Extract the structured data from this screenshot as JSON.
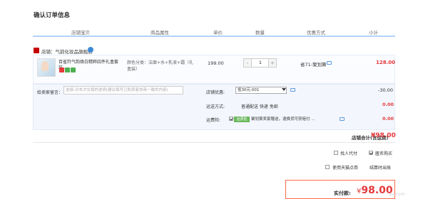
{
  "title": "确认订单信息",
  "columns": [
    "店铺宝贝",
    "商品属性",
    "单价",
    "数量",
    "优惠方式",
    "小计"
  ],
  "store": {
    "label": "店铺：气韵化妆品旗舰店"
  },
  "item": {
    "name_line1": "百雀羚气韵焕白精粹四件礼盒套",
    "name_line2": "装...",
    "attr_line1": "颜色分类：洁面+水+乳液+霜（礼",
    "attr_line2": "盒装）",
    "price": "199.00",
    "quantity": "1",
    "minus": "-",
    "plus": "+",
    "promo": "省71:聚划算",
    "subtotal": "128.00",
    "tag_colors": [
      "#e4393c",
      "#4caf50",
      "#4caf50"
    ]
  },
  "message": {
    "label": "给卖家留言：",
    "placeholder": "选填:对本次交易的说明(建议填写已和卖家协商一致的内容)"
  },
  "store_discount": {
    "label": "店铺优惠:",
    "value": "省30元:001",
    "amount": "-30.00"
  },
  "shipping": {
    "label": "运送方式:",
    "value": "普通配送 快递 免邮",
    "amount": "0.00"
  },
  "insurance": {
    "label": "运费险:",
    "tag": "运费险",
    "text": "聚划算卖家赠送，退换货可获赔付 ...",
    "amount": "0.00"
  },
  "store_total": {
    "label": "店铺合计(含运费)",
    "value": "¥98.00"
  },
  "options": {
    "proxy": "找人代付",
    "anonymous": "匿名购买",
    "tmall_points": "使用天猫点券",
    "settle_bill": "结算时出账"
  },
  "payment": {
    "label": "实付款:",
    "symbol": "¥",
    "value": "98.00"
  },
  "watermark": "uu.com",
  "colors": {
    "accent": "#e4393c",
    "header_line": "#b2d1ff",
    "pay_border": "#ff6b4a"
  }
}
